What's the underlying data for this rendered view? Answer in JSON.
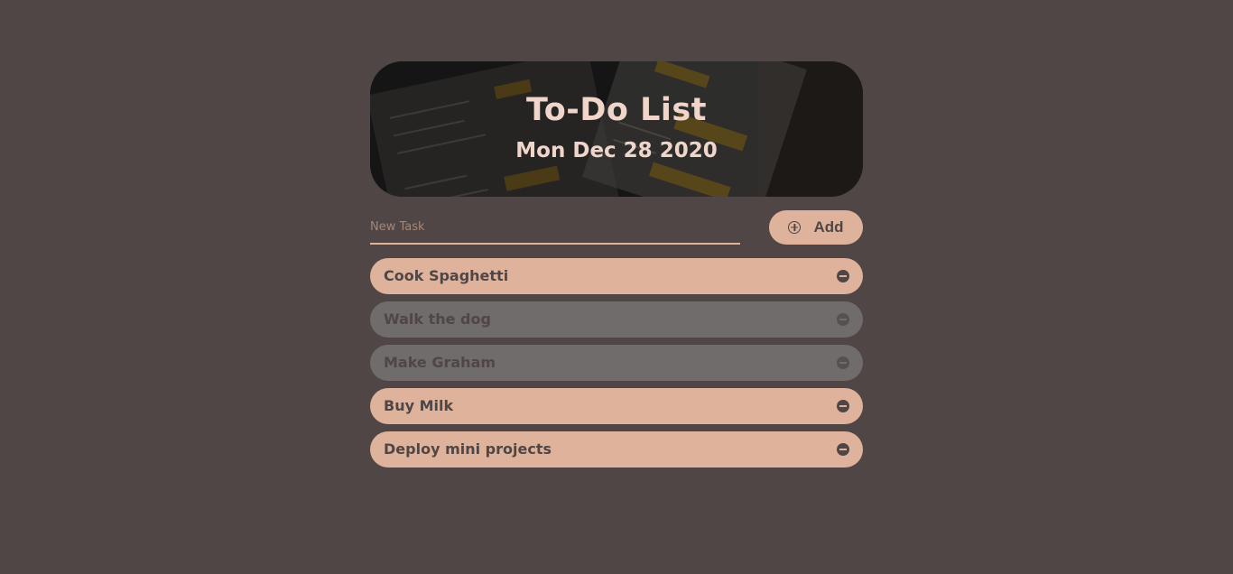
{
  "header": {
    "title": "To-Do List",
    "date": "Mon Dec 28 2020"
  },
  "form": {
    "placeholder": "New Task",
    "value": "",
    "add_label": "Add"
  },
  "tasks": [
    {
      "label": "Cook Spaghetti",
      "done": false
    },
    {
      "label": "Walk the dog",
      "done": true
    },
    {
      "label": "Make Graham",
      "done": true
    },
    {
      "label": "Buy Milk",
      "done": false
    },
    {
      "label": "Deploy mini projects",
      "done": false
    }
  ],
  "colors": {
    "background": "#504646",
    "accent": "#dfb39b",
    "done": "#706c6c",
    "header_text": "#f0d6ca"
  },
  "icons": {
    "add": "plus-circle-icon",
    "remove": "minus-circle-icon"
  }
}
